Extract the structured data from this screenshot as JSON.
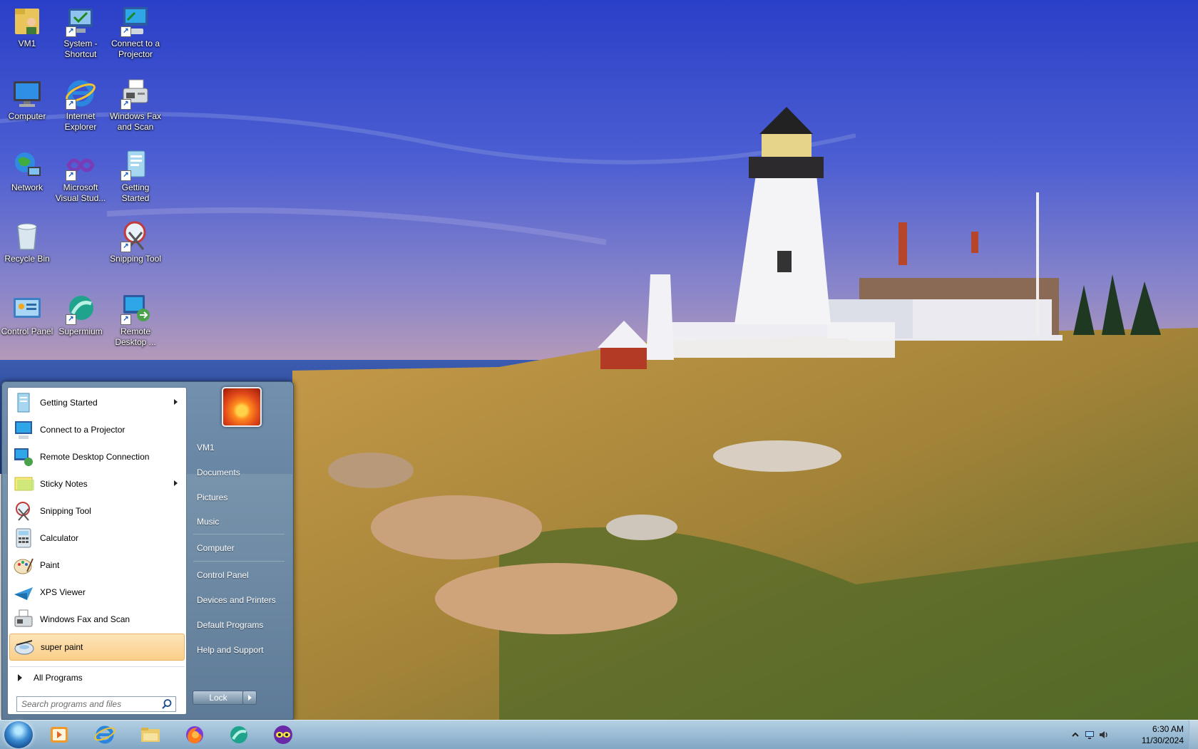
{
  "desktop": {
    "icons": [
      {
        "label": "VM1"
      },
      {
        "label": "System - Shortcut"
      },
      {
        "label": "Connect to a Projector"
      },
      {
        "label": "Computer"
      },
      {
        "label": "Internet Explorer"
      },
      {
        "label": "Windows Fax and Scan"
      },
      {
        "label": "Network"
      },
      {
        "label": "Microsoft Visual Stud..."
      },
      {
        "label": "Getting Started"
      },
      {
        "label": "Recycle Bin"
      },
      {
        "label": "Snipping Tool"
      },
      {
        "label": "Control Panel"
      },
      {
        "label": "Supermium"
      },
      {
        "label": "Remote Desktop ..."
      }
    ]
  },
  "start_menu": {
    "programs": [
      {
        "label": "Getting Started",
        "has_submenu": true
      },
      {
        "label": "Connect to a Projector",
        "has_submenu": false
      },
      {
        "label": "Remote Desktop Connection",
        "has_submenu": false
      },
      {
        "label": "Sticky Notes",
        "has_submenu": true
      },
      {
        "label": "Snipping Tool",
        "has_submenu": false
      },
      {
        "label": "Calculator",
        "has_submenu": false
      },
      {
        "label": "Paint",
        "has_submenu": false
      },
      {
        "label": "XPS Viewer",
        "has_submenu": false
      },
      {
        "label": "Windows Fax and Scan",
        "has_submenu": false
      },
      {
        "label": "super paint",
        "has_submenu": false,
        "highlighted": true
      }
    ],
    "all_programs_label": "All Programs",
    "search_placeholder": "Search programs and files",
    "right_links": [
      {
        "label": "VM1"
      },
      {
        "label": "Documents"
      },
      {
        "label": "Pictures"
      },
      {
        "label": "Music"
      },
      {
        "label": "Computer"
      },
      {
        "label": "Control Panel"
      },
      {
        "label": "Devices and Printers"
      },
      {
        "label": "Default Programs"
      },
      {
        "label": "Help and Support"
      }
    ],
    "lock_label": "Lock"
  },
  "taskbar": {
    "pinned": [
      {
        "icon": "media-player-icon"
      },
      {
        "icon": "internet-explorer-icon"
      },
      {
        "icon": "file-explorer-icon"
      },
      {
        "icon": "firefox-icon"
      },
      {
        "icon": "supermium-icon"
      },
      {
        "icon": "spy-app-icon"
      }
    ],
    "clock": {
      "time": "6:30 AM",
      "date": "11/30/2024"
    }
  },
  "colors": {
    "menu_highlight": "#fbcf8a",
    "taskbar": "#8fb4d2",
    "sky_top": "#2a3fc8",
    "sea": "#2b4f9e"
  }
}
